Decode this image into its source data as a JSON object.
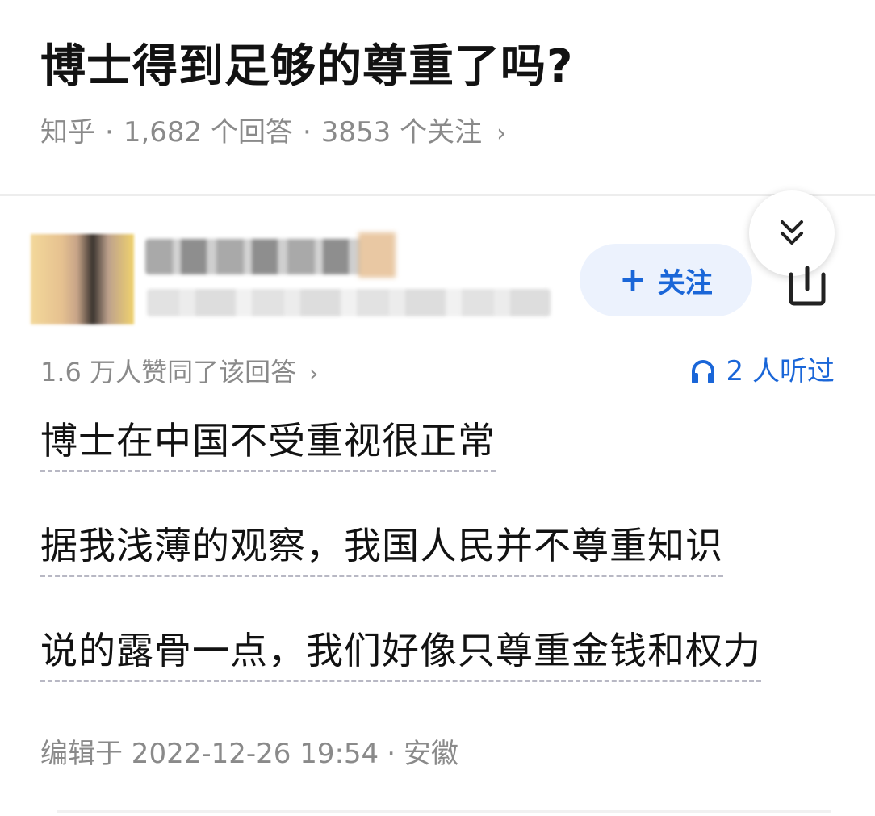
{
  "question": {
    "title": "博士得到足够的尊重了吗?",
    "source": "知乎",
    "answers": "1,682 个回答",
    "followers": "3853 个关注",
    "separator": "·",
    "chevron": "›"
  },
  "answer": {
    "follow_label": "关注",
    "follow_plus": "+",
    "likes": "1.6 万人赞同了该回答",
    "likes_chevron": "›",
    "listened": "2 人听过",
    "paragraphs": [
      "博士在中国不受重视很正常",
      "据我浅薄的观察，我国人民并不尊重知识",
      "说的露骨一点，我们好像只尊重金钱和权力"
    ],
    "edited_time": "编辑于 2022-12-26 19:54",
    "separator": "·",
    "location": "安徽"
  },
  "icons": [
    "collapse-double-chevron-icon",
    "share-icon",
    "headphones-icon",
    "chevron-right-icon"
  ],
  "colors": {
    "accent": "#1a66d8",
    "follow_bg": "#ecf2fd",
    "meta_gray": "#8a8a8a"
  }
}
